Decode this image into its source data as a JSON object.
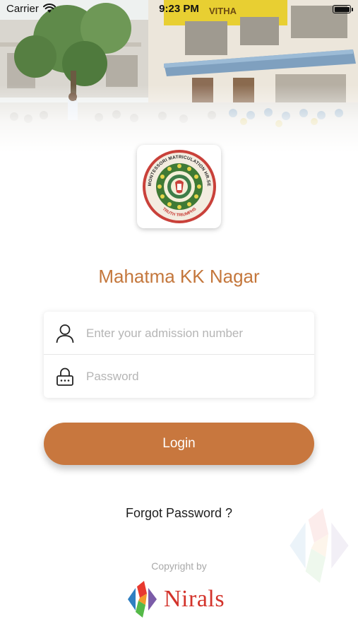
{
  "status_bar": {
    "carrier": "Carrier",
    "time": "9:23 PM",
    "wifi_icon": "wifi-icon",
    "battery_icon": "battery-icon",
    "battery_level": 1.0
  },
  "header": {
    "background_image": "school-building-photo",
    "building_sign_text": "VITHA"
  },
  "logo": {
    "icon": "school-crest-logo",
    "crest_ring_text": "MAHATMA MONTESSORI MATRICULATION HR.SEC.SCHOOL",
    "motto": "TRUTH TRIUMPHS"
  },
  "app_title": "Mahatma KK Nagar",
  "form": {
    "admission": {
      "icon": "user-icon",
      "placeholder": "Enter your admission number",
      "value": ""
    },
    "password": {
      "icon": "lock-icon",
      "placeholder": "Password",
      "value": ""
    }
  },
  "login_button": {
    "label": "Login"
  },
  "forgot_password": {
    "label": "Forgot Password ?"
  },
  "footer": {
    "copyright": "Copyright by",
    "brand_icon": "nirals-logo-icon",
    "brand_name": "Nirals"
  },
  "colors": {
    "accent": "#c8773e",
    "title": "#c4773c",
    "brand_red": "#d3332b"
  }
}
